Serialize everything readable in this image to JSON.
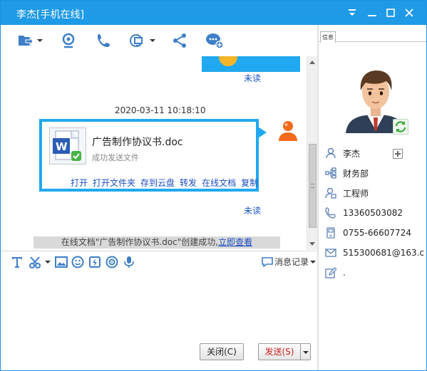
{
  "window": {
    "title": "李杰[手机在线]",
    "accent": "#1e9ae6"
  },
  "titlebar": {
    "controls": [
      "pin-icon",
      "minimize-icon",
      "maximize-icon",
      "close-icon"
    ]
  },
  "toolbar": {
    "buttons": [
      {
        "icon": "send-file-icon",
        "dropdown": true
      },
      {
        "icon": "webcam-icon",
        "dropdown": false
      },
      {
        "icon": "phone-icon",
        "dropdown": false
      },
      {
        "icon": "remote-desktop-icon",
        "dropdown": true
      },
      {
        "icon": "share-icon",
        "dropdown": false
      },
      {
        "icon": "group-chat-icon",
        "dropdown": false
      }
    ]
  },
  "chat": {
    "prev_status": "未读",
    "timestamp": "2020-03-11 10:18:10",
    "file_message": {
      "file_name": "广告制作协议书.doc",
      "status": "成功发送文件",
      "actions": [
        "打开",
        "打开文件夹",
        "存到云盘",
        "转发",
        "在线文档",
        "复制"
      ],
      "read_status": "未读",
      "bubble_color": "#20a9f0"
    },
    "notice": {
      "text": "在线文档\"广告制作协议书.doc\"创建成功,",
      "link": "立即查看"
    }
  },
  "input_toolbar": {
    "tools": [
      "font-icon",
      "screenshot-icon",
      "image-icon",
      "emoji-icon",
      "shake-icon",
      "voice-message-icon",
      "microphone-icon"
    ],
    "history_label": "消息记录"
  },
  "input": {
    "value": ""
  },
  "buttons": {
    "close_label": "关闭(C)",
    "send_label": "发送(S)"
  },
  "right_panel": {
    "tab_label": "信息",
    "contact": {
      "name": "李杰",
      "department": "财务部",
      "title": "工程师",
      "mobile": "13360503082",
      "phone": "0755-66607724",
      "email": "515300681@163.c",
      "signature": "."
    }
  }
}
